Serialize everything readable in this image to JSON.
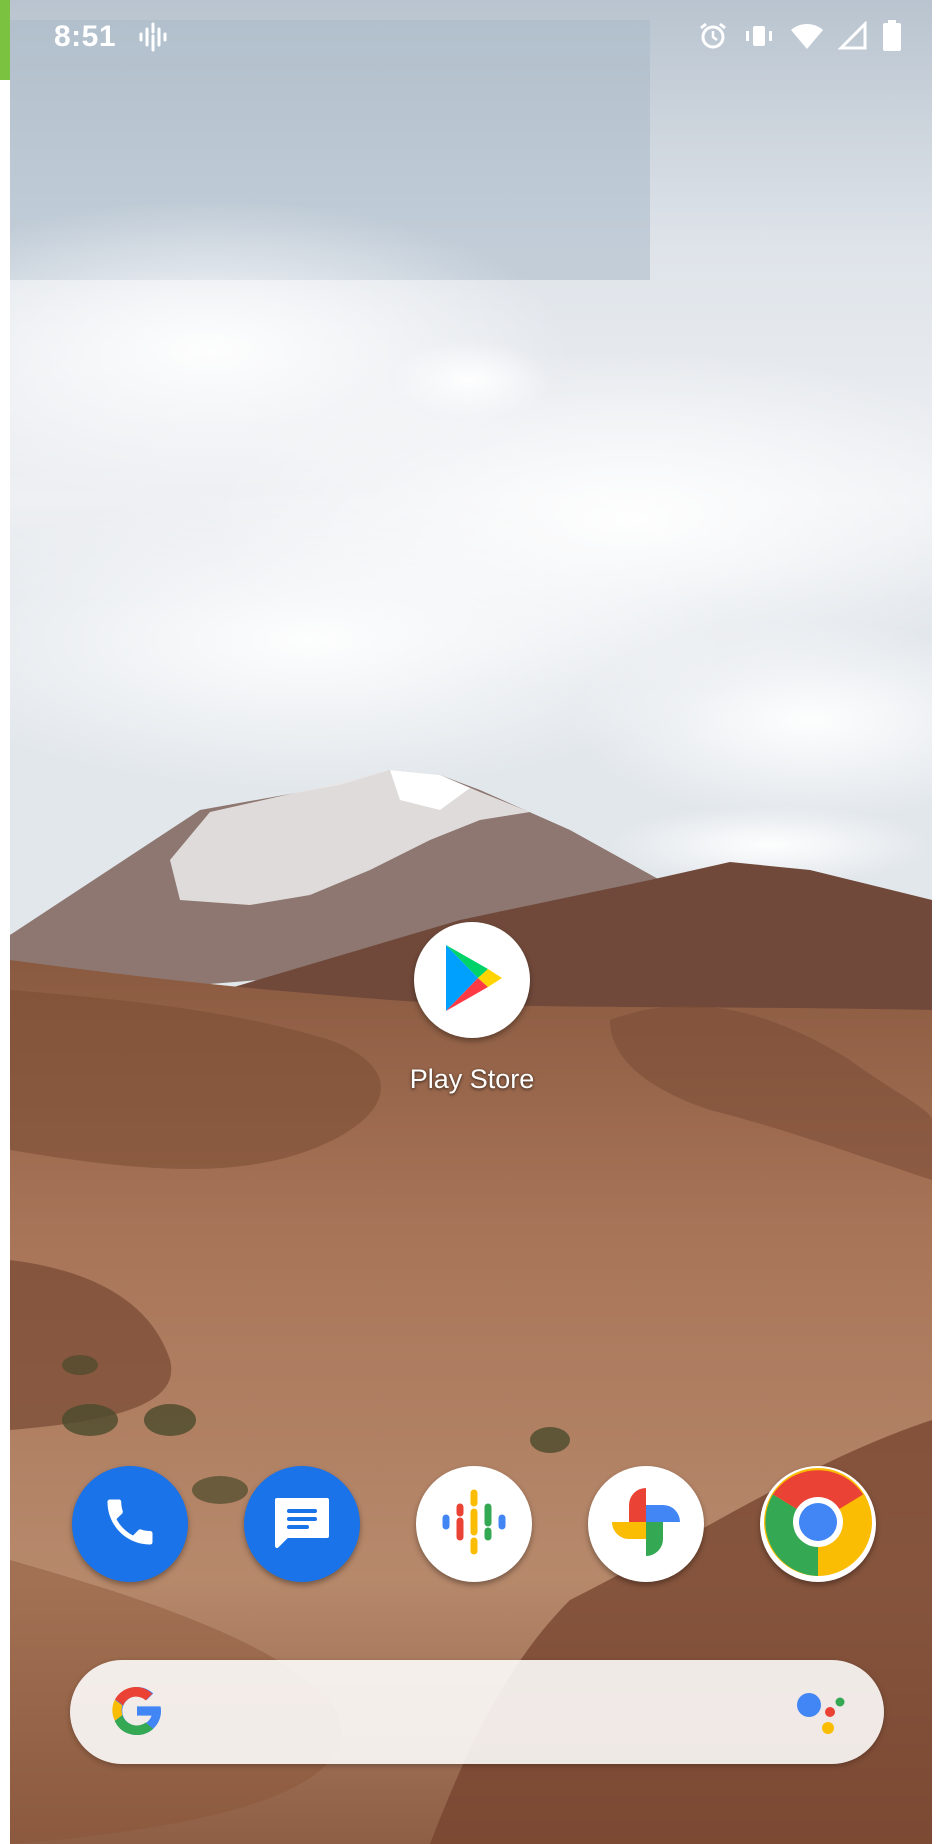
{
  "status_bar": {
    "time": "8:51",
    "icons": [
      "podcast-notification-icon",
      "alarm-icon",
      "vibrate-icon",
      "wifi-icon",
      "cell-signal-icon",
      "battery-icon"
    ]
  },
  "home": {
    "apps": [
      {
        "label": "Play Store",
        "icon": "play-store-icon"
      }
    ]
  },
  "dock": [
    {
      "icon": "phone-icon",
      "color": "#1a73e8"
    },
    {
      "icon": "messages-icon",
      "color": "#1a73e8"
    },
    {
      "icon": "podcasts-icon",
      "color": "#ffffff"
    },
    {
      "icon": "photos-icon",
      "color": "#ffffff"
    },
    {
      "icon": "chrome-icon",
      "color": "#ffffff"
    }
  ],
  "search_bar": {
    "left_icon": "google-g-icon",
    "right_icon": "assistant-icon"
  },
  "colors": {
    "accent": "#1a73e8",
    "edge_tab": "#7cc241"
  }
}
